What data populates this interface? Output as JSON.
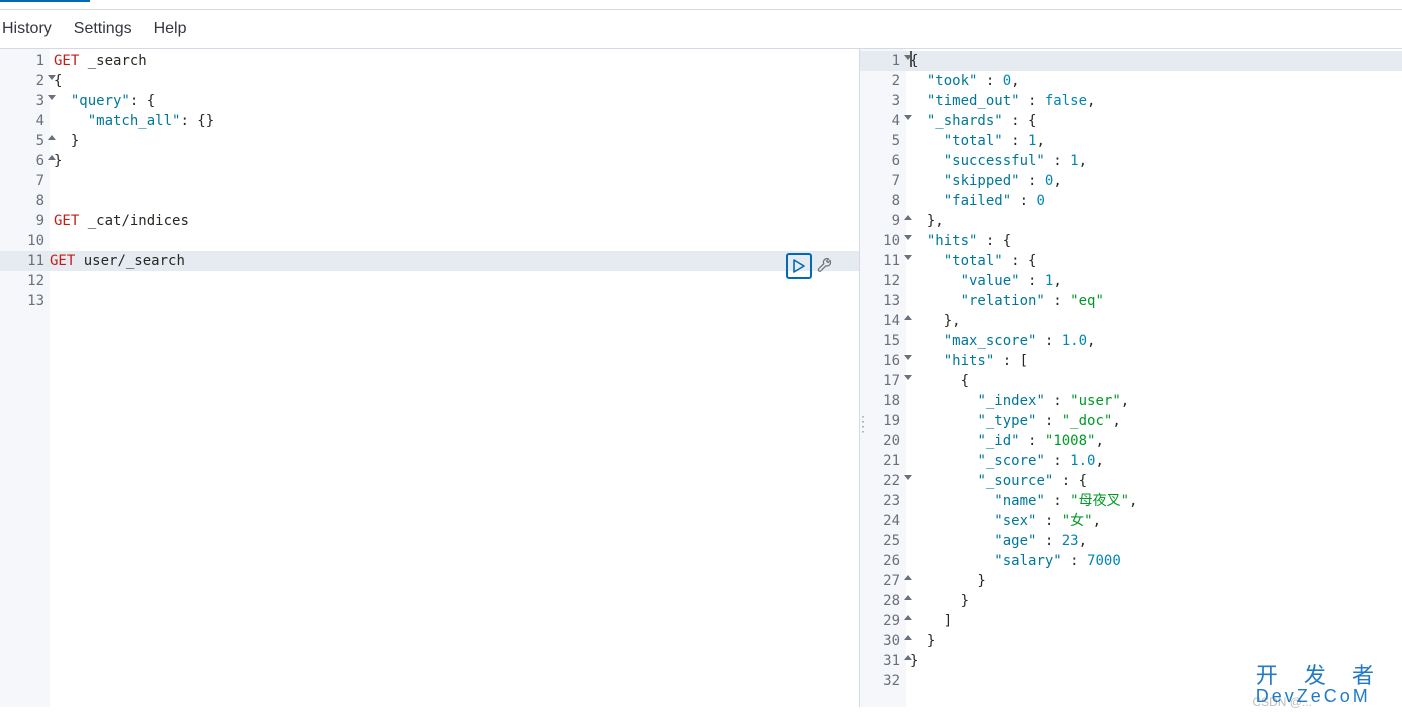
{
  "menu": {
    "history": "History",
    "settings": "Settings",
    "help": "Help"
  },
  "leftEditor": {
    "lines": [
      {
        "n": 1,
        "fold": "",
        "tokens": [
          [
            "method",
            "GET"
          ],
          [
            "path",
            " _search"
          ]
        ]
      },
      {
        "n": 2,
        "fold": "open",
        "tokens": [
          [
            "punc",
            "{"
          ]
        ]
      },
      {
        "n": 3,
        "fold": "open",
        "tokens": [
          [
            "punc",
            "  "
          ],
          [
            "key",
            "\"query\""
          ],
          [
            "punc",
            ": {"
          ]
        ]
      },
      {
        "n": 4,
        "fold": "",
        "tokens": [
          [
            "punc",
            "    "
          ],
          [
            "key",
            "\"match_all\""
          ],
          [
            "punc",
            ": {}"
          ]
        ]
      },
      {
        "n": 5,
        "fold": "close",
        "tokens": [
          [
            "punc",
            "  }"
          ]
        ]
      },
      {
        "n": 6,
        "fold": "close",
        "tokens": [
          [
            "punc",
            "}"
          ]
        ]
      },
      {
        "n": 7,
        "fold": "",
        "tokens": []
      },
      {
        "n": 8,
        "fold": "",
        "tokens": []
      },
      {
        "n": 9,
        "fold": "",
        "tokens": [
          [
            "method",
            "GET"
          ],
          [
            "path",
            " _cat/indices"
          ]
        ]
      },
      {
        "n": 10,
        "fold": "",
        "tokens": []
      },
      {
        "n": 11,
        "fold": "",
        "hl": true,
        "tokens": [
          [
            "method",
            "GET"
          ],
          [
            "path",
            " user/_search"
          ]
        ]
      },
      {
        "n": 12,
        "fold": "",
        "tokens": []
      },
      {
        "n": 13,
        "fold": "",
        "tokens": []
      }
    ]
  },
  "rightEditor": {
    "lines": [
      {
        "n": 1,
        "fold": "open",
        "tokens": [
          [
            "punc",
            "{"
          ]
        ]
      },
      {
        "n": 2,
        "fold": "",
        "tokens": [
          [
            "punc",
            "  "
          ],
          [
            "key",
            "\"took\""
          ],
          [
            "punc",
            " : "
          ],
          [
            "num",
            "0"
          ],
          [
            "punc",
            ","
          ]
        ]
      },
      {
        "n": 3,
        "fold": "",
        "tokens": [
          [
            "punc",
            "  "
          ],
          [
            "key",
            "\"timed_out\""
          ],
          [
            "punc",
            " : "
          ],
          [
            "bool",
            "false"
          ],
          [
            "punc",
            ","
          ]
        ]
      },
      {
        "n": 4,
        "fold": "open",
        "tokens": [
          [
            "punc",
            "  "
          ],
          [
            "key",
            "\"_shards\""
          ],
          [
            "punc",
            " : {"
          ]
        ]
      },
      {
        "n": 5,
        "fold": "",
        "tokens": [
          [
            "punc",
            "    "
          ],
          [
            "key",
            "\"total\""
          ],
          [
            "punc",
            " : "
          ],
          [
            "num",
            "1"
          ],
          [
            "punc",
            ","
          ]
        ]
      },
      {
        "n": 6,
        "fold": "",
        "tokens": [
          [
            "punc",
            "    "
          ],
          [
            "key",
            "\"successful\""
          ],
          [
            "punc",
            " : "
          ],
          [
            "num",
            "1"
          ],
          [
            "punc",
            ","
          ]
        ]
      },
      {
        "n": 7,
        "fold": "",
        "tokens": [
          [
            "punc",
            "    "
          ],
          [
            "key",
            "\"skipped\""
          ],
          [
            "punc",
            " : "
          ],
          [
            "num",
            "0"
          ],
          [
            "punc",
            ","
          ]
        ]
      },
      {
        "n": 8,
        "fold": "",
        "tokens": [
          [
            "punc",
            "    "
          ],
          [
            "key",
            "\"failed\""
          ],
          [
            "punc",
            " : "
          ],
          [
            "num",
            "0"
          ]
        ]
      },
      {
        "n": 9,
        "fold": "close",
        "tokens": [
          [
            "punc",
            "  },"
          ]
        ]
      },
      {
        "n": 10,
        "fold": "open",
        "tokens": [
          [
            "punc",
            "  "
          ],
          [
            "key",
            "\"hits\""
          ],
          [
            "punc",
            " : {"
          ]
        ]
      },
      {
        "n": 11,
        "fold": "open",
        "tokens": [
          [
            "punc",
            "    "
          ],
          [
            "key",
            "\"total\""
          ],
          [
            "punc",
            " : {"
          ]
        ]
      },
      {
        "n": 12,
        "fold": "",
        "tokens": [
          [
            "punc",
            "      "
          ],
          [
            "key",
            "\"value\""
          ],
          [
            "punc",
            " : "
          ],
          [
            "num",
            "1"
          ],
          [
            "punc",
            ","
          ]
        ]
      },
      {
        "n": 13,
        "fold": "",
        "tokens": [
          [
            "punc",
            "      "
          ],
          [
            "key",
            "\"relation\""
          ],
          [
            "punc",
            " : "
          ],
          [
            "str",
            "\"eq\""
          ]
        ]
      },
      {
        "n": 14,
        "fold": "close",
        "tokens": [
          [
            "punc",
            "    },"
          ]
        ]
      },
      {
        "n": 15,
        "fold": "",
        "tokens": [
          [
            "punc",
            "    "
          ],
          [
            "key",
            "\"max_score\""
          ],
          [
            "punc",
            " : "
          ],
          [
            "num",
            "1.0"
          ],
          [
            "punc",
            ","
          ]
        ]
      },
      {
        "n": 16,
        "fold": "open",
        "tokens": [
          [
            "punc",
            "    "
          ],
          [
            "key",
            "\"hits\""
          ],
          [
            "punc",
            " : ["
          ]
        ]
      },
      {
        "n": 17,
        "fold": "open",
        "tokens": [
          [
            "punc",
            "      {"
          ]
        ]
      },
      {
        "n": 18,
        "fold": "",
        "tokens": [
          [
            "punc",
            "        "
          ],
          [
            "key",
            "\"_index\""
          ],
          [
            "punc",
            " : "
          ],
          [
            "str",
            "\"user\""
          ],
          [
            "punc",
            ","
          ]
        ]
      },
      {
        "n": 19,
        "fold": "",
        "tokens": [
          [
            "punc",
            "        "
          ],
          [
            "key",
            "\"_type\""
          ],
          [
            "punc",
            " : "
          ],
          [
            "str",
            "\"_doc\""
          ],
          [
            "punc",
            ","
          ]
        ]
      },
      {
        "n": 20,
        "fold": "",
        "tokens": [
          [
            "punc",
            "        "
          ],
          [
            "key",
            "\"_id\""
          ],
          [
            "punc",
            " : "
          ],
          [
            "str",
            "\"1008\""
          ],
          [
            "punc",
            ","
          ]
        ]
      },
      {
        "n": 21,
        "fold": "",
        "tokens": [
          [
            "punc",
            "        "
          ],
          [
            "key",
            "\"_score\""
          ],
          [
            "punc",
            " : "
          ],
          [
            "num",
            "1.0"
          ],
          [
            "punc",
            ","
          ]
        ]
      },
      {
        "n": 22,
        "fold": "open",
        "tokens": [
          [
            "punc",
            "        "
          ],
          [
            "key",
            "\"_source\""
          ],
          [
            "punc",
            " : {"
          ]
        ]
      },
      {
        "n": 23,
        "fold": "",
        "tokens": [
          [
            "punc",
            "          "
          ],
          [
            "key",
            "\"name\""
          ],
          [
            "punc",
            " : "
          ],
          [
            "str",
            "\"母夜叉\""
          ],
          [
            "punc",
            ","
          ]
        ]
      },
      {
        "n": 24,
        "fold": "",
        "tokens": [
          [
            "punc",
            "          "
          ],
          [
            "key",
            "\"sex\""
          ],
          [
            "punc",
            " : "
          ],
          [
            "str",
            "\"女\""
          ],
          [
            "punc",
            ","
          ]
        ]
      },
      {
        "n": 25,
        "fold": "",
        "tokens": [
          [
            "punc",
            "          "
          ],
          [
            "key",
            "\"age\""
          ],
          [
            "punc",
            " : "
          ],
          [
            "num",
            "23"
          ],
          [
            "punc",
            ","
          ]
        ]
      },
      {
        "n": 26,
        "fold": "",
        "tokens": [
          [
            "punc",
            "          "
          ],
          [
            "key",
            "\"salary\""
          ],
          [
            "punc",
            " : "
          ],
          [
            "num",
            "7000"
          ]
        ]
      },
      {
        "n": 27,
        "fold": "close",
        "tokens": [
          [
            "punc",
            "        }"
          ]
        ]
      },
      {
        "n": 28,
        "fold": "close",
        "tokens": [
          [
            "punc",
            "      }"
          ]
        ]
      },
      {
        "n": 29,
        "fold": "close",
        "tokens": [
          [
            "punc",
            "    ]"
          ]
        ]
      },
      {
        "n": 30,
        "fold": "close",
        "tokens": [
          [
            "punc",
            "  }"
          ]
        ]
      },
      {
        "n": 31,
        "fold": "close",
        "tokens": [
          [
            "punc",
            "}"
          ]
        ]
      },
      {
        "n": 32,
        "fold": "",
        "tokens": []
      }
    ]
  },
  "watermark": {
    "line1": "开 发 者",
    "line2": "DevZeCoM",
    "csdn": "CSDN @..."
  }
}
